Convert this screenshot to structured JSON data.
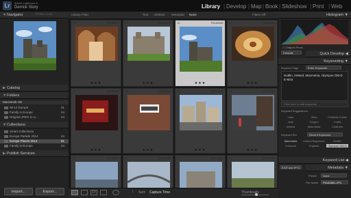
{
  "app": {
    "name": "Adobe Lightroom 6",
    "user": "Derrick Story",
    "logo": "Lr"
  },
  "modules": [
    {
      "label": "Library",
      "active": true
    },
    {
      "label": "Develop",
      "active": false
    },
    {
      "label": "Map",
      "active": false
    },
    {
      "label": "Book",
      "active": false
    },
    {
      "label": "Slideshow",
      "active": false
    },
    {
      "label": "Print",
      "active": false
    },
    {
      "label": "Web",
      "active": false
    }
  ],
  "left": {
    "navigator": "Navigator",
    "navigator_modes": [
      "FIT",
      "FILL",
      "1:1",
      "3:1"
    ],
    "catalog": "Catalog",
    "folders": "Folders",
    "volume": "Macintosh HD",
    "folder_items": [
      {
        "label": "06-14 Europe",
        "count": "31"
      },
      {
        "label": "Family in Europe",
        "count": "24"
      },
      {
        "label": "Original JPEG to Li...",
        "count": "24"
      }
    ],
    "collections": "Collections",
    "collection_items": [
      {
        "label": "Smart Collections",
        "count": ""
      },
      {
        "label": "Europe Parade 2014",
        "count": "24"
      },
      {
        "label": "Europe Places 2014",
        "count": "81"
      },
      {
        "label": "Family in Europe",
        "count": "24"
      }
    ],
    "publish": "Publish Services",
    "import": "Import...",
    "export": "Export..."
  },
  "filter": {
    "label": "Library Filter:",
    "text": "Text",
    "attribute": "Attribute",
    "metadata": "Metadata",
    "none": "None",
    "filters_off": "Filters Off"
  },
  "cells": [
    {
      "idx": "17",
      "pid": "P6160023",
      "stars": "★★★"
    },
    {
      "idx": "18",
      "pid": "P6160883",
      "stars": "★★★"
    },
    {
      "idx": "19",
      "pid": "P6160881",
      "stars": "★★★"
    },
    {
      "idx": "20",
      "pid": "P6160883",
      "stars": "★★★"
    },
    {
      "idx": "21",
      "pid": "P6160057",
      "stars": "★★★"
    },
    {
      "idx": "22",
      "pid": "P6160083",
      "stars": "★★★"
    },
    {
      "idx": "23",
      "pid": "P6160081",
      "stars": "★★★"
    },
    {
      "idx": "24",
      "pid": "P6160083",
      "stars": "★★★"
    },
    {
      "idx": "25",
      "pid": "P6160017",
      "stars": ""
    },
    {
      "idx": "26",
      "pid": "P6160031",
      "stars": ""
    },
    {
      "idx": "27",
      "pid": "IMG_0062",
      "stars": ""
    },
    {
      "idx": "28",
      "pid": "P6160083",
      "stars": ""
    }
  ],
  "toolbar": {
    "sort_label": "Sort:",
    "sort_value": "Capture Time",
    "thumbs_label": "Thumbnails"
  },
  "right": {
    "histogram": "Histogram",
    "original_photo": "Original Photo",
    "defaults": "Defaults",
    "quick_develop": "Quick Develop",
    "keywording": "Keywording",
    "keyword_tags": "Keyword Tags",
    "enter_keywords": "Enter Keywords",
    "keywords_text": "Dublin, Ireland, Macmania, Olympus OM-D E-M10",
    "click_to_add": "Click here to add keywords",
    "suggestions": "Keyword Suggestions",
    "suggestion_items": [
      "Lake",
      "Olive",
      "Celebrity Cruise",
      "Italy",
      "Oregon",
      "Crafts",
      "Ireland",
      "Macmania",
      "Chatham"
    ],
    "keyword_set": "Keyword Set",
    "recent_keywords": "Recent Keywords",
    "set_items": [
      "Macmania",
      "Ireland Bayphone",
      "Dublin",
      "Liverpool",
      "England",
      "Olympus OM-D"
    ],
    "keyword_list": "Keyword List",
    "metadata": "Metadata",
    "exif_label": "EXIF and IPTC",
    "preset_label": "Preset",
    "preset_value": "None",
    "filename_label": "File Name",
    "filename_value": "P6182881.JPG"
  }
}
